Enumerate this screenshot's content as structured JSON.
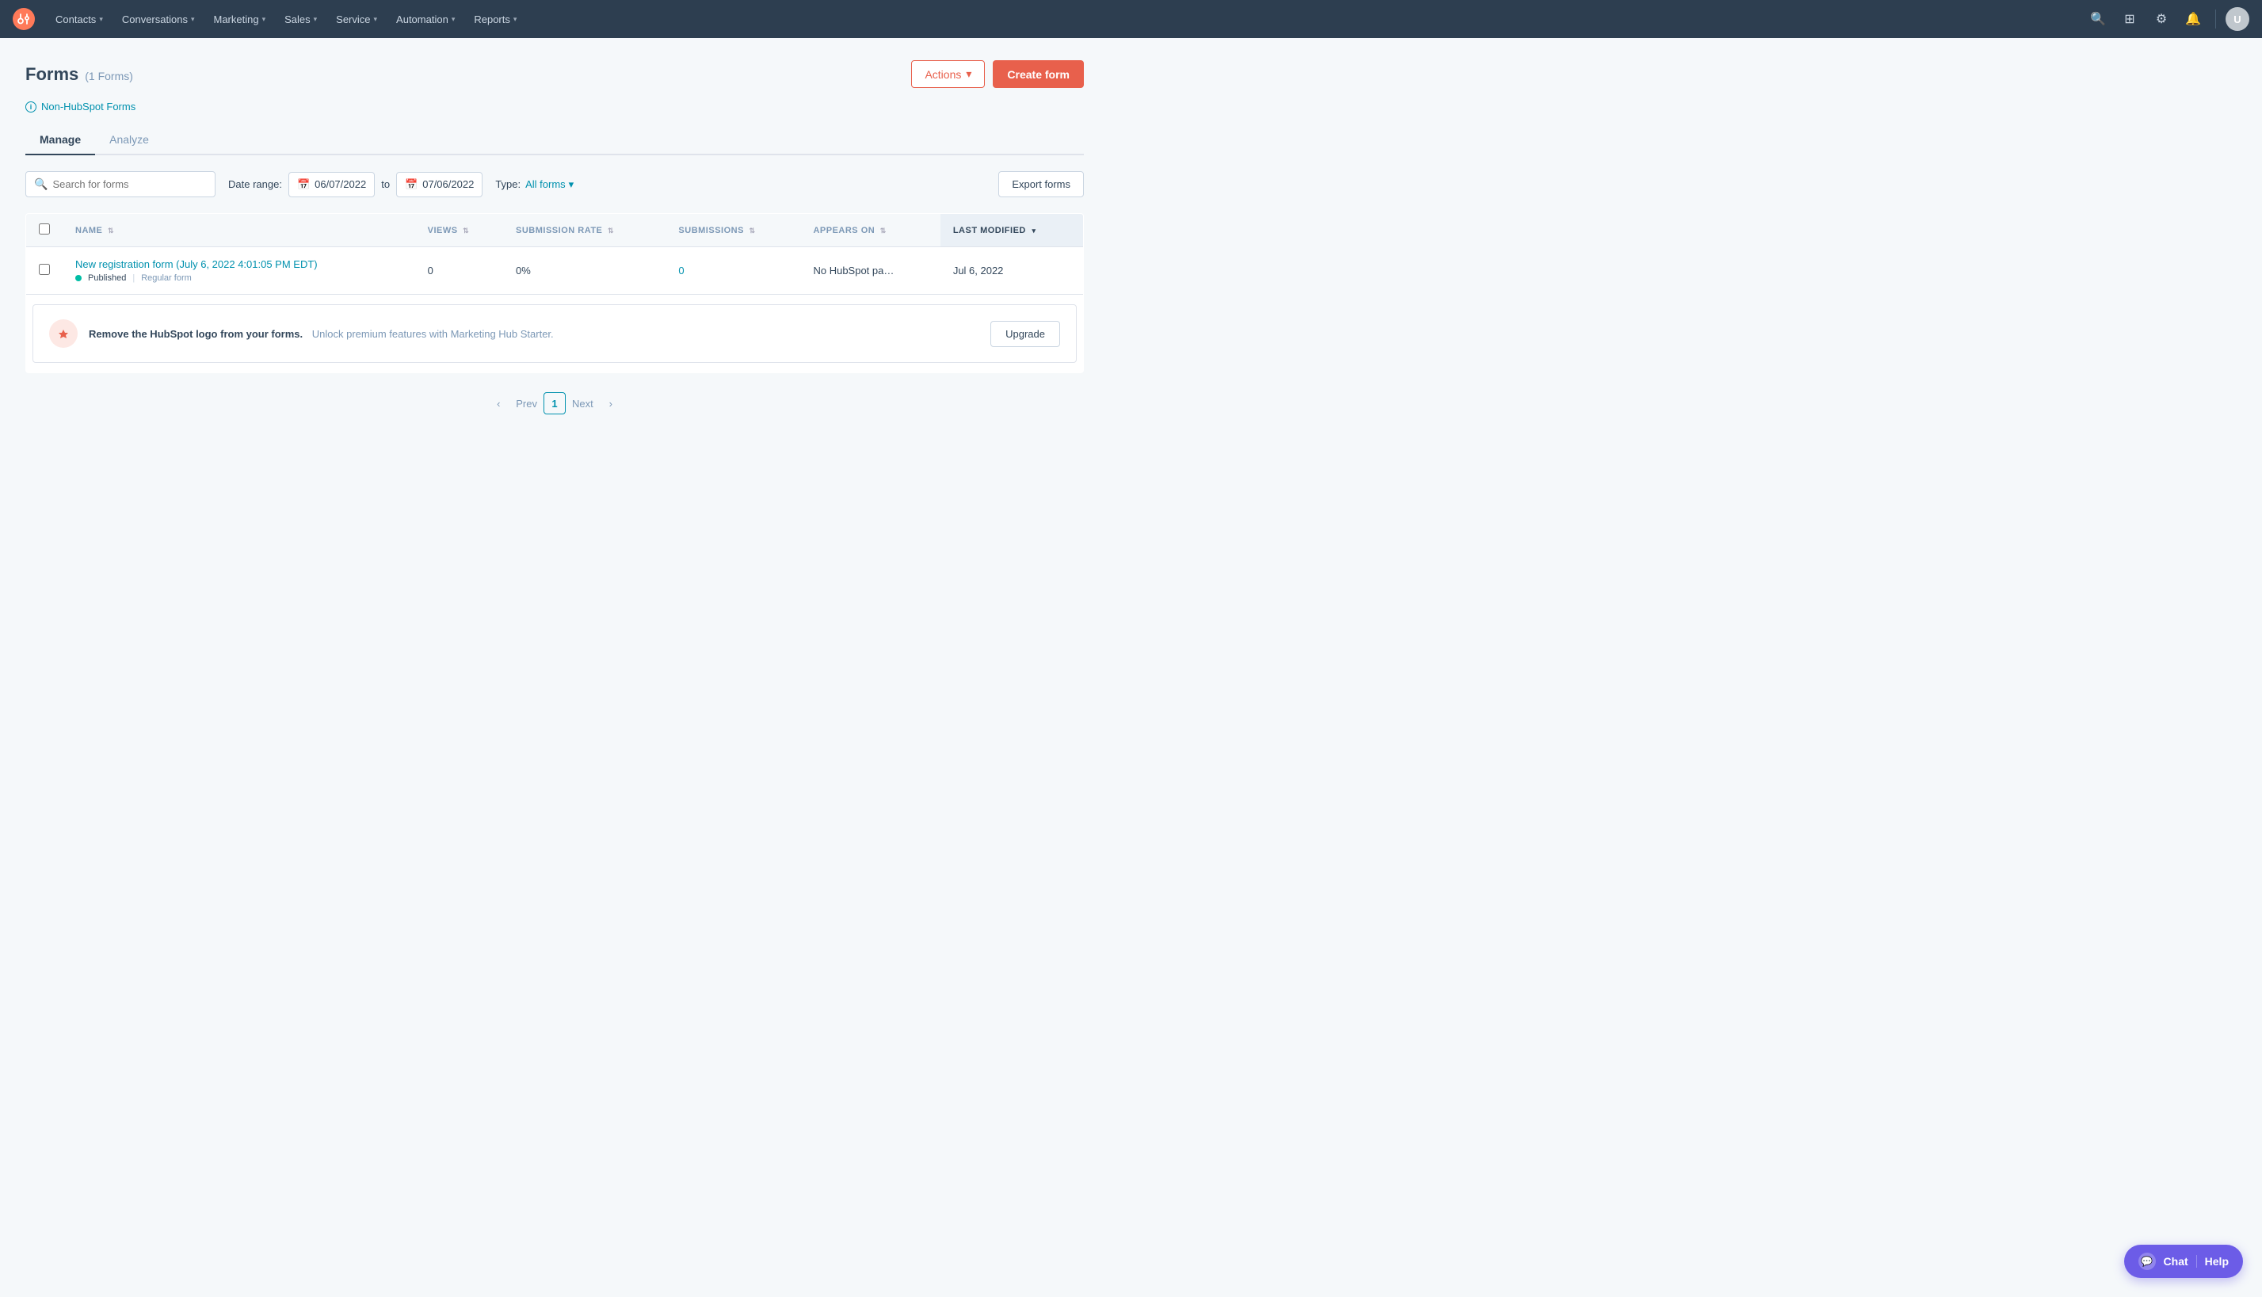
{
  "nav": {
    "items": [
      {
        "label": "Contacts",
        "id": "contacts"
      },
      {
        "label": "Conversations",
        "id": "conversations"
      },
      {
        "label": "Marketing",
        "id": "marketing"
      },
      {
        "label": "Sales",
        "id": "sales"
      },
      {
        "label": "Service",
        "id": "service"
      },
      {
        "label": "Automation",
        "id": "automation"
      },
      {
        "label": "Reports",
        "id": "reports"
      }
    ]
  },
  "page": {
    "title": "Forms",
    "count": "(1 Forms)",
    "non_hubspot_label": "Non-HubSpot Forms",
    "tabs": [
      {
        "label": "Manage",
        "active": true
      },
      {
        "label": "Analyze",
        "active": false
      }
    ],
    "actions_label": "Actions",
    "create_form_label": "Create form"
  },
  "filters": {
    "search_placeholder": "Search for forms",
    "date_range_label": "Date range:",
    "date_from": "06/07/2022",
    "date_to": "07/06/2022",
    "type_label": "Type:",
    "type_value": "All forms",
    "export_label": "Export forms"
  },
  "table": {
    "columns": [
      {
        "label": "NAME",
        "sortable": true
      },
      {
        "label": "VIEWS",
        "sortable": true
      },
      {
        "label": "SUBMISSION RATE",
        "sortable": true
      },
      {
        "label": "SUBMISSIONS",
        "sortable": true
      },
      {
        "label": "APPEARS ON",
        "sortable": true
      },
      {
        "label": "LAST MODIFIED",
        "sortable": true,
        "active": true
      }
    ],
    "rows": [
      {
        "name": "New registration form (July 6, 2022 4:01:05 PM EDT)",
        "status": "Published",
        "type": "Regular form",
        "views": "0",
        "submission_rate": "0%",
        "submissions": "0",
        "appears_on": "No HubSpot pa…",
        "last_modified": "Jul 6, 2022"
      }
    ]
  },
  "upgrade_banner": {
    "title": "Remove the HubSpot logo from your forms.",
    "description": "Unlock premium features with Marketing Hub Starter.",
    "btn_label": "Upgrade"
  },
  "pagination": {
    "prev_label": "Prev",
    "next_label": "Next",
    "current_page": "1"
  },
  "chat": {
    "label": "Chat",
    "help_label": "Help"
  }
}
